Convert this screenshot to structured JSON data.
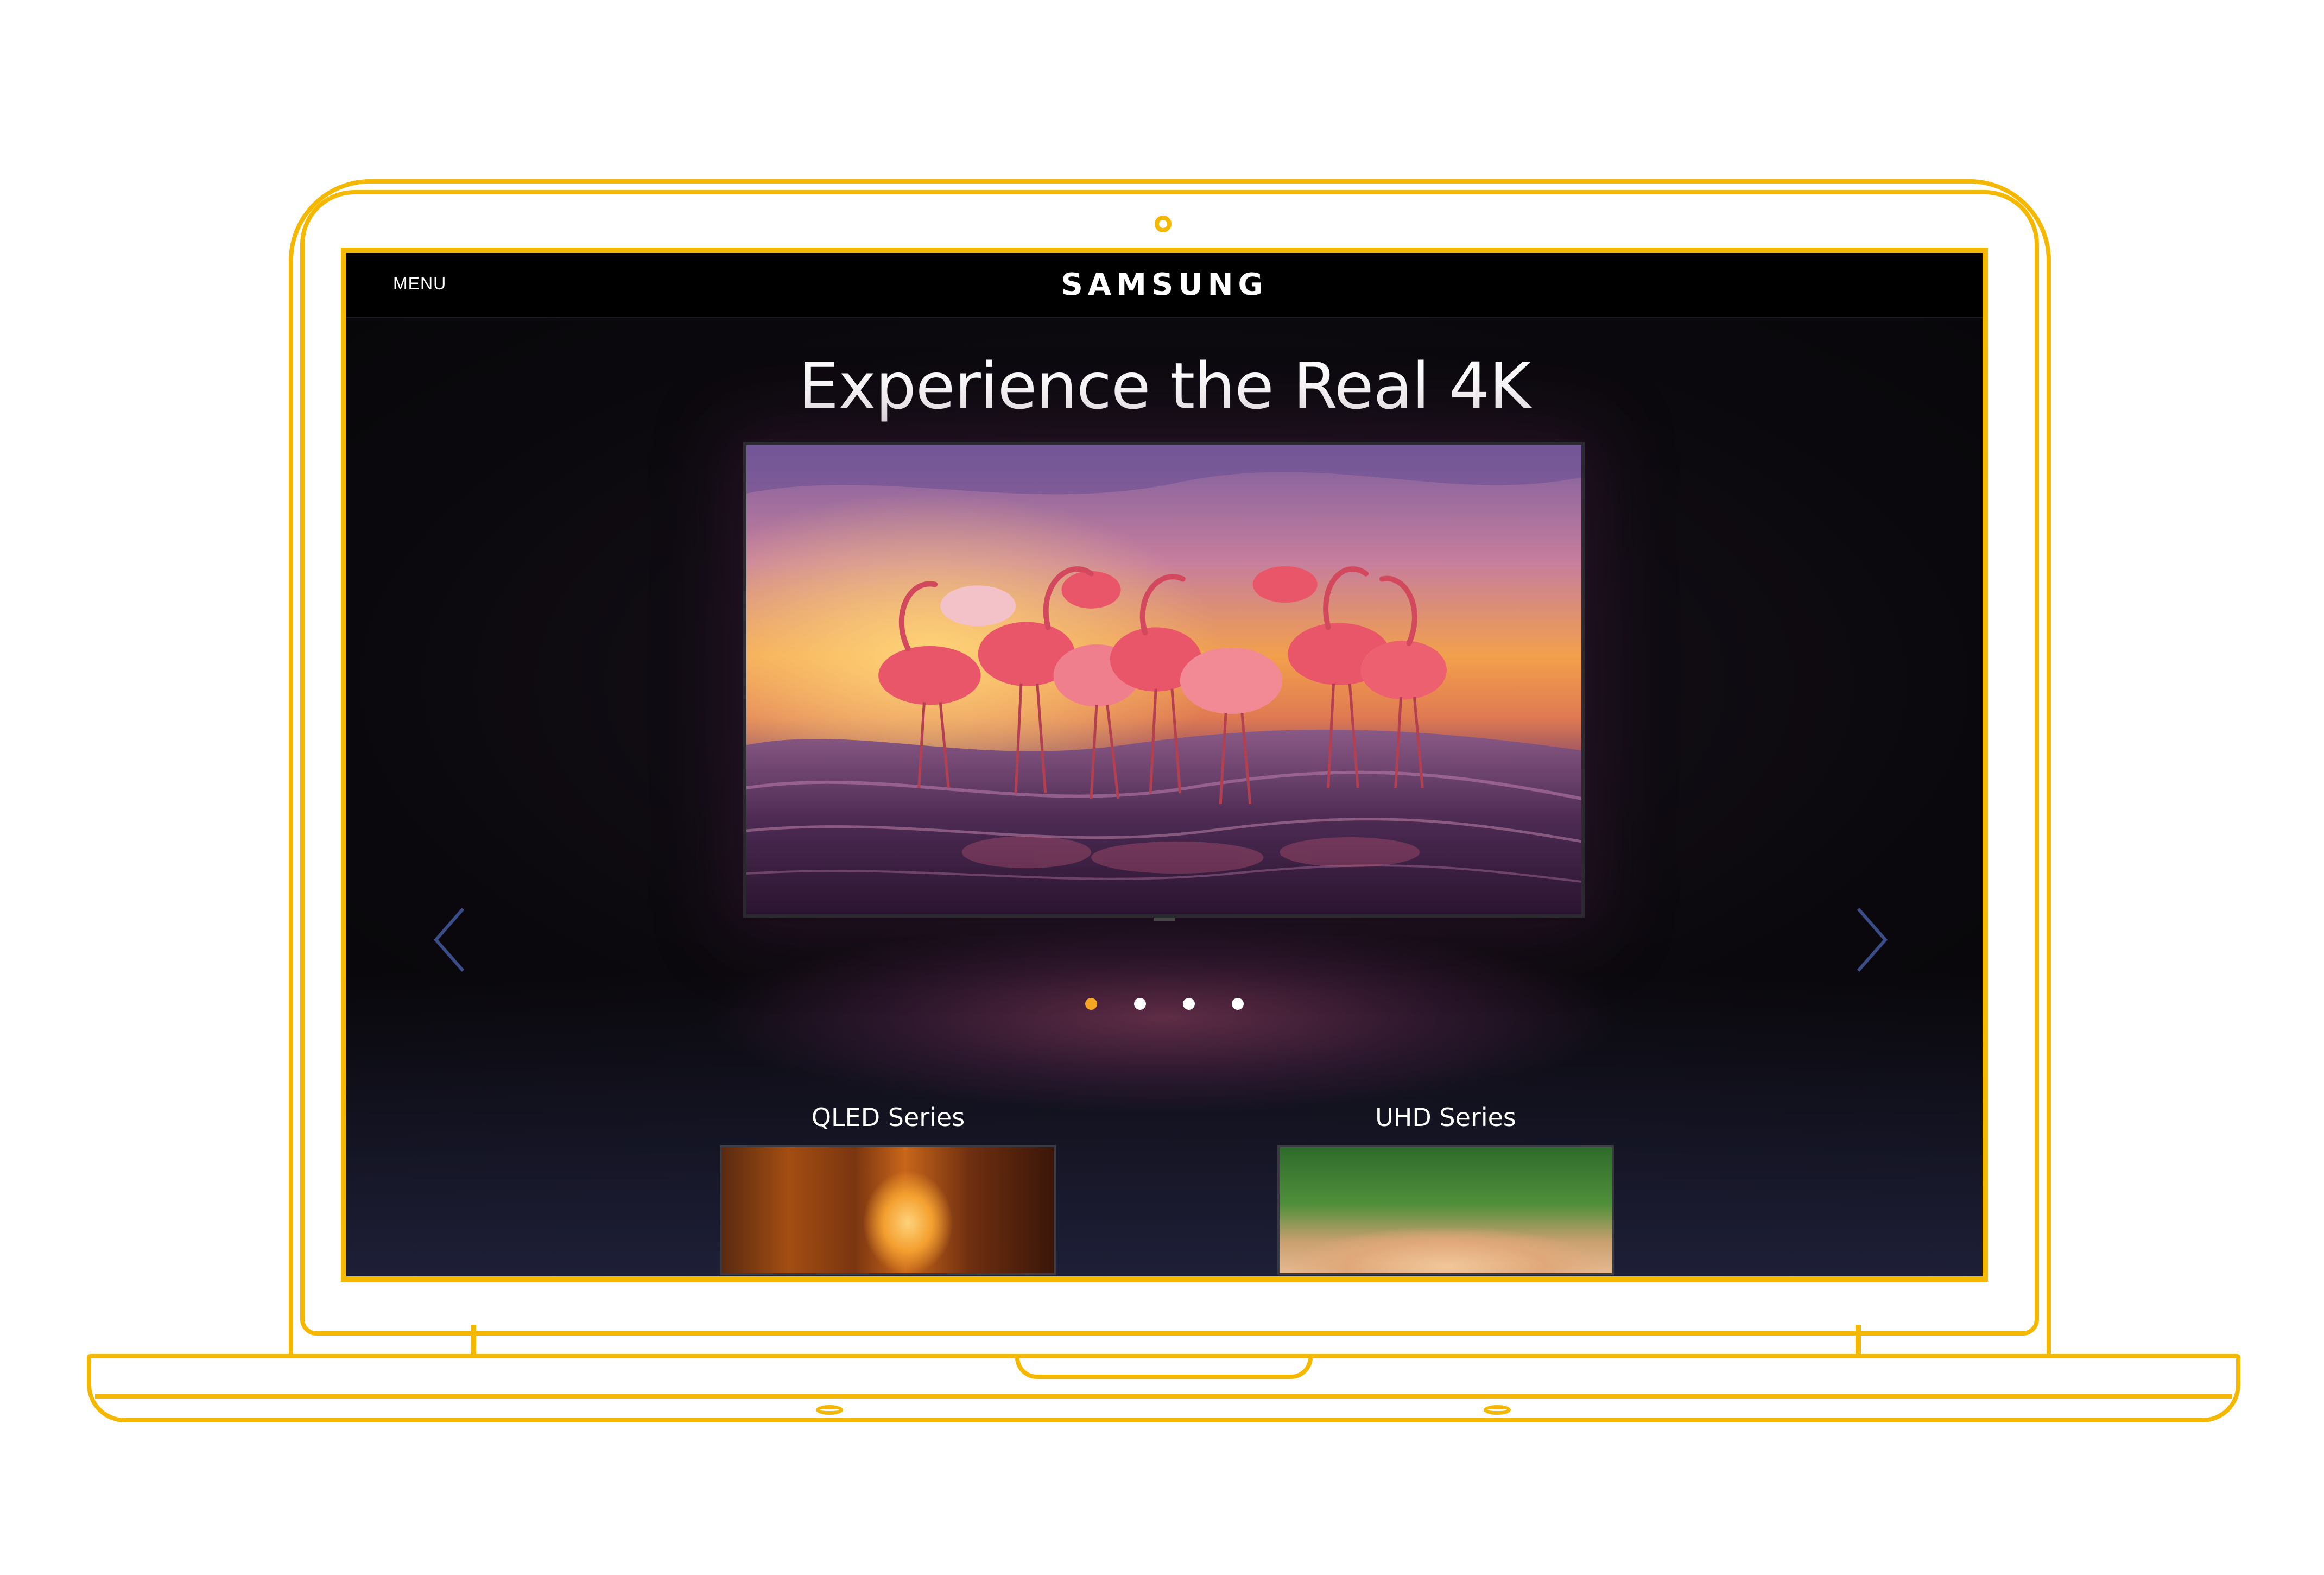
{
  "header": {
    "menu_label": "MENU",
    "brand": "SAMSUNG"
  },
  "hero": {
    "headline": "Experience the Real 4K",
    "slide_count": 4,
    "active_slide": 1
  },
  "series": [
    {
      "title": "QLED Series"
    },
    {
      "title": "UHD Series"
    }
  ],
  "icons": {
    "prev": "chevron-left-icon",
    "next": "chevron-right-icon",
    "webcam": "webcam-icon"
  },
  "colors": {
    "frame_outline": "#f5b800",
    "active_dot": "#f5a623",
    "inactive_dot": "#ffffff",
    "screen_background": "#050407"
  }
}
